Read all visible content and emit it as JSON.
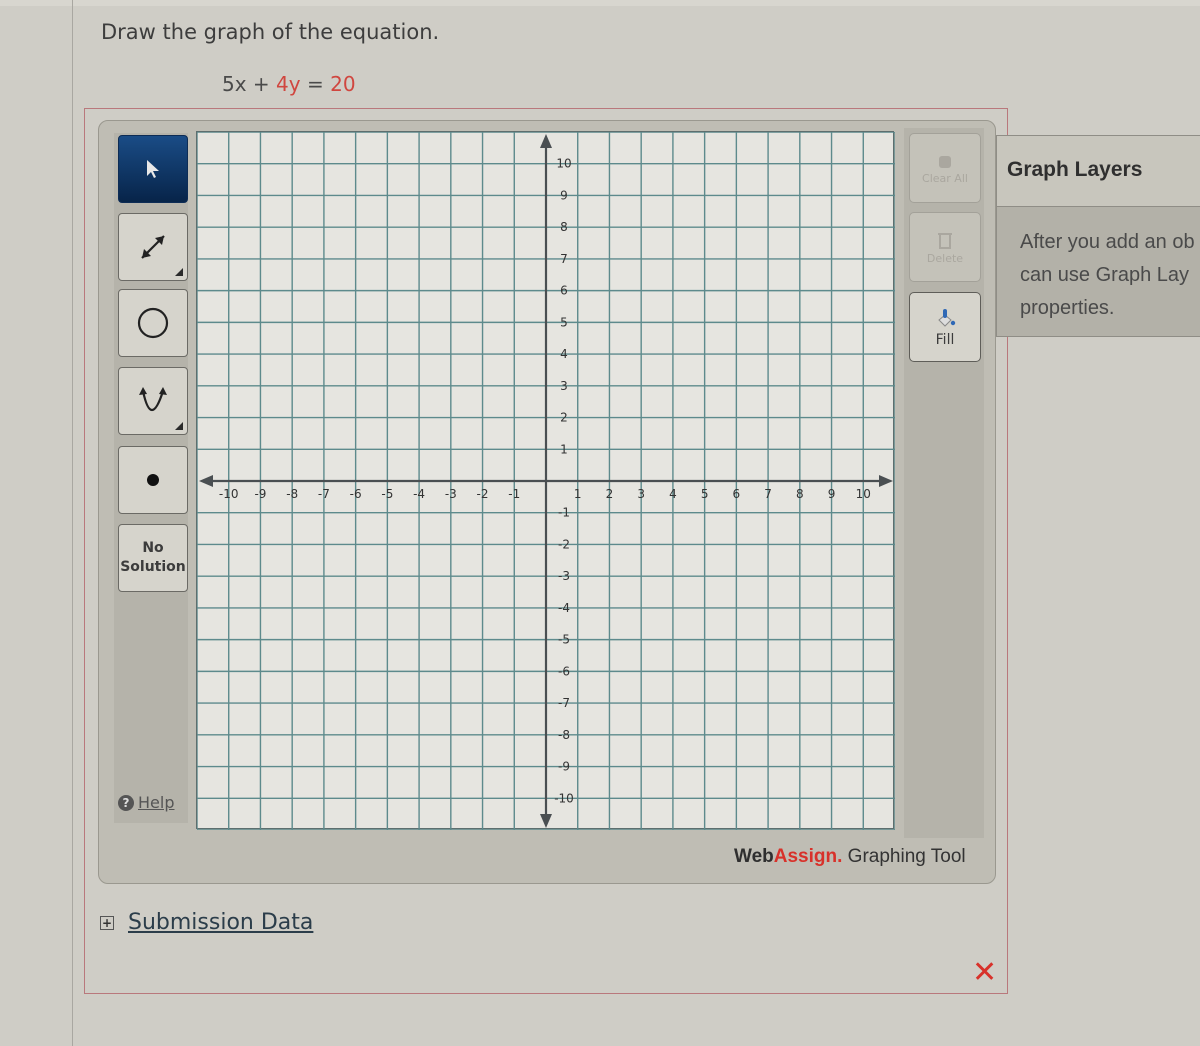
{
  "question": {
    "prompt": "Draw the graph of the equation.",
    "equation_parts": {
      "a": "5x + ",
      "b": "4y",
      "eq": " = ",
      "c": "20"
    }
  },
  "toolbar_left": {
    "tools": [
      {
        "name": "pointer",
        "icon": "pointer-arrow-icon",
        "active": true
      },
      {
        "name": "line",
        "icon": "line-icon",
        "active": false,
        "has_submenu": true
      },
      {
        "name": "circle",
        "icon": "circle-icon",
        "active": false
      },
      {
        "name": "parabola",
        "icon": "parabola-icon",
        "active": false,
        "has_submenu": true
      },
      {
        "name": "point",
        "icon": "point-icon",
        "active": false
      }
    ],
    "no_solution_line1": "No",
    "no_solution_line2": "Solution",
    "help_label": "Help"
  },
  "toolbar_right": {
    "buttons": [
      {
        "label": "Clear All",
        "icon": "clear-icon",
        "enabled": false
      },
      {
        "label": "Delete",
        "icon": "trash-icon",
        "enabled": false
      },
      {
        "label": "Fill",
        "icon": "fill-bucket-icon",
        "enabled": true
      }
    ]
  },
  "graph": {
    "x_range": [
      -11,
      11
    ],
    "y_range": [
      -11,
      11
    ],
    "x_ticks": [
      -10,
      -9,
      -8,
      -7,
      -6,
      -5,
      -4,
      -3,
      -2,
      -1,
      1,
      2,
      3,
      4,
      5,
      6,
      7,
      8,
      9,
      10
    ],
    "y_ticks": [
      10,
      9,
      8,
      7,
      6,
      5,
      4,
      3,
      2,
      1,
      -1,
      -2,
      -3,
      -4,
      -5,
      -6,
      -7,
      -8,
      -9,
      -10
    ],
    "grid_step": 1,
    "grid_color": "#5d8a8c",
    "axis_color": "#4a4f52"
  },
  "branding": {
    "web": "Web",
    "assign": "Assign.",
    "tool": " Graphing Tool"
  },
  "graph_layers": {
    "title": "Graph Layers",
    "lines": [
      "After you add an ob",
      "can use Graph Lay",
      "properties."
    ]
  },
  "submission": {
    "label": "Submission Data",
    "toggle": "+"
  },
  "status": {
    "result_icon": "incorrect-x-icon",
    "result_glyph": "✕",
    "color": "#d8312a"
  }
}
